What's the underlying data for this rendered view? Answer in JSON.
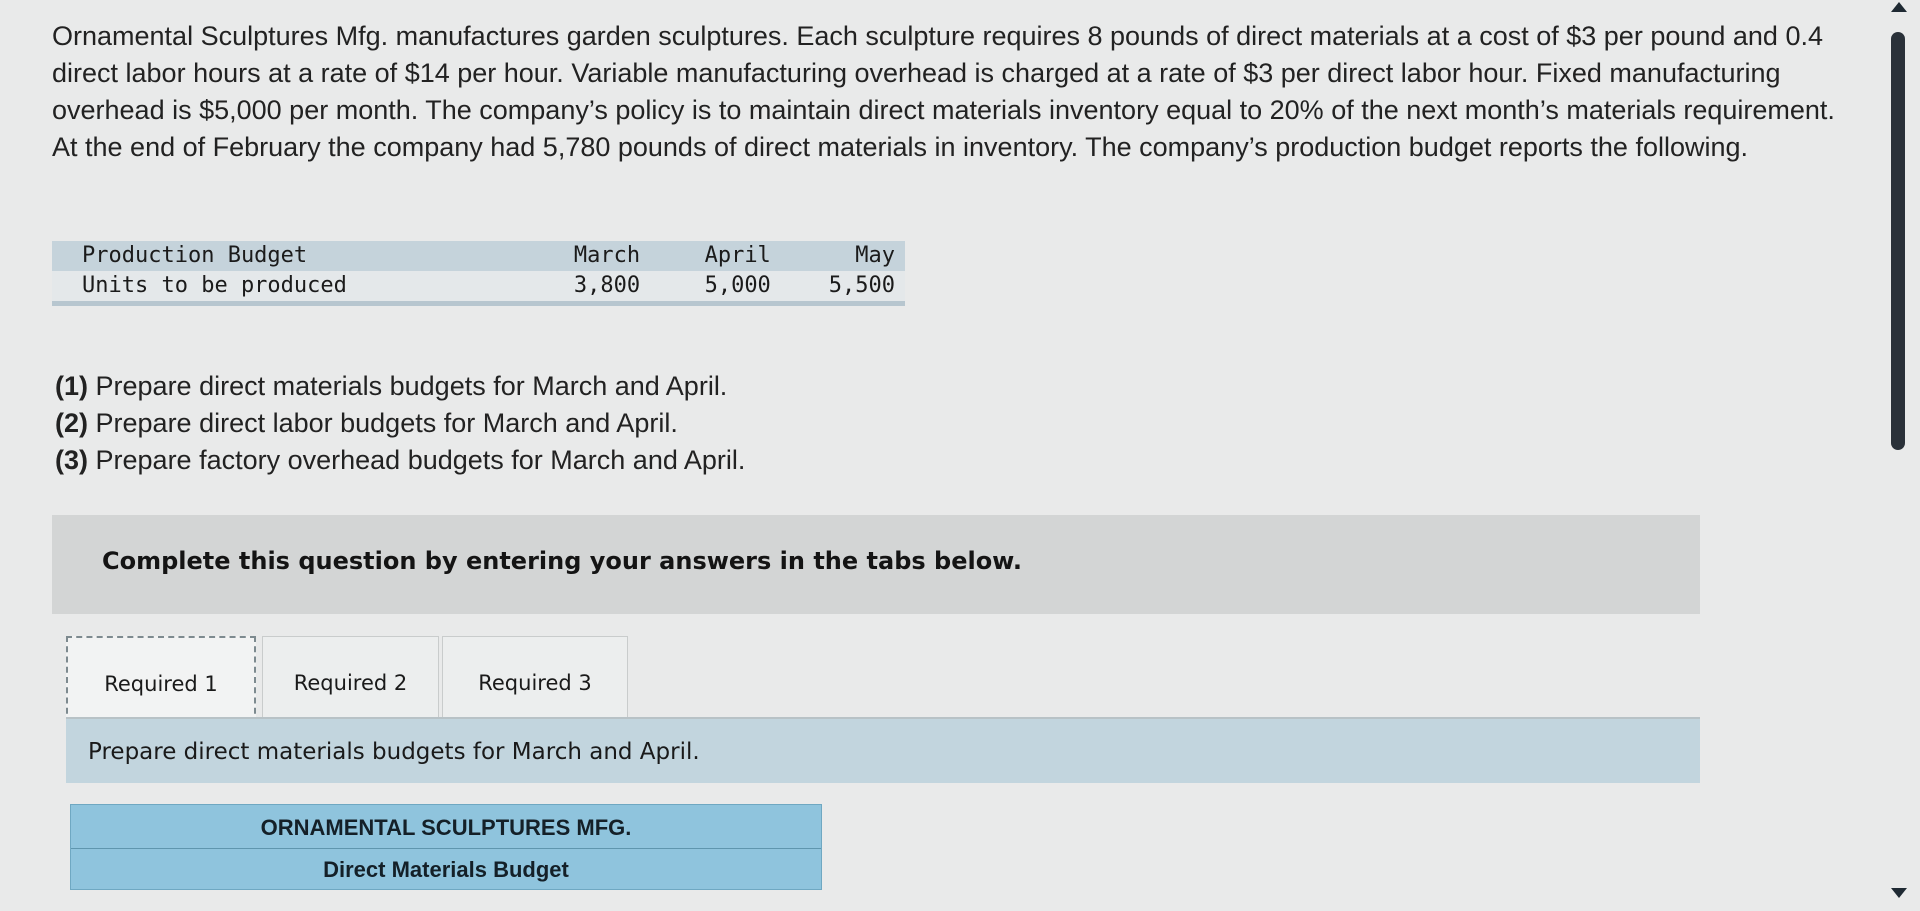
{
  "problem": {
    "intro": "Ornamental Sculptures Mfg. manufactures garden sculptures. Each sculpture requires 8 pounds of direct materials at a cost of $3 per pound and 0.4 direct labor hours at a rate of $14 per hour. Variable manufacturing overhead is charged at a rate of $3 per direct labor hour. Fixed manufacturing overhead is $5,000 per month. The company’s policy is to maintain direct materials inventory equal to 20% of the next month’s materials requirement. At the end of February the company had 5,780 pounds of direct materials in inventory. The company’s production budget reports the following."
  },
  "production_budget": {
    "header": {
      "label": "Production Budget",
      "months": [
        "March",
        "April",
        "May"
      ]
    },
    "row": {
      "label": "Units to be produced",
      "values": [
        "3,800",
        "5,000",
        "5,500"
      ]
    }
  },
  "questions": [
    {
      "num": "(1)",
      "text": "Prepare direct materials budgets for March and April."
    },
    {
      "num": "(2)",
      "text": "Prepare direct labor budgets for March and April."
    },
    {
      "num": "(3)",
      "text": "Prepare factory overhead budgets for March and April."
    }
  ],
  "instructions": {
    "complete": "Complete this question by entering your answers in the tabs below."
  },
  "tabs": [
    {
      "label": "Required 1",
      "active": true
    },
    {
      "label": "Required 2",
      "active": false
    },
    {
      "label": "Required 3",
      "active": false
    }
  ],
  "current_tab": {
    "instruction": "Prepare direct materials budgets for March and April."
  },
  "budget_form": {
    "company": "ORNAMENTAL SCULPTURES MFG.",
    "title": "Direct Materials Budget"
  }
}
